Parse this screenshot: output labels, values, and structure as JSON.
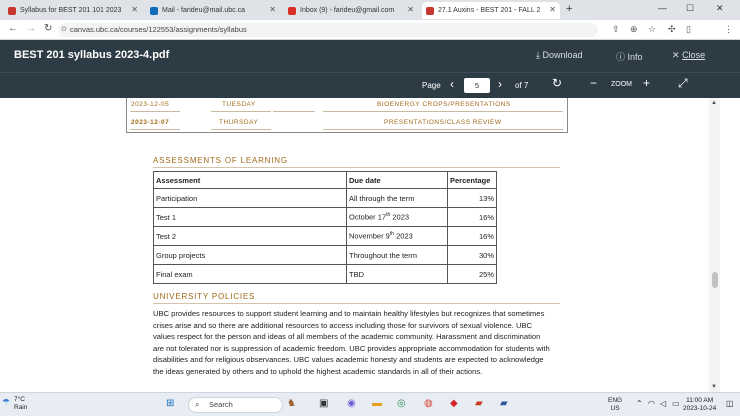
{
  "browser": {
    "tabs": [
      {
        "label": "Syllabus for BEST 201 101 2023",
        "color": "#c7372f",
        "active": false
      },
      {
        "label": "Mail - farideu@mail.ubc.ca",
        "color": "#0f6cbd",
        "active": false
      },
      {
        "label": "Inbox (9) - farideu@gmail.com",
        "color": "#d93025",
        "active": false
      },
      {
        "label": "27.1 Auxins - BEST 201 - FALL 2",
        "color": "#c7372f",
        "active": true
      }
    ],
    "new_tab": "+",
    "url": "canvas.ubc.ca/courses/122553/assignments/syllabus"
  },
  "viewer": {
    "title": "BEST 201 syllabus 2023-4.pdf",
    "download": "Download",
    "info": "Info",
    "close": "Close",
    "page_label": "Page",
    "page_value": "5",
    "page_total": "of 7",
    "zoom_label": "ZOOM"
  },
  "schedule": [
    {
      "date": "2023-12-05",
      "day": "TUESDAY",
      "topic": "BIOENERGY CROPS/PRESENTATIONS"
    },
    {
      "date": "2023-12-07",
      "day": "THURSDAY",
      "topic": "PRESENTATIONS/CLASS REVIEW"
    }
  ],
  "assessments": {
    "heading": "ASSESSMENTS OF LEARNING",
    "columns": [
      "Assessment",
      "Due date",
      "Percentage"
    ],
    "rows": [
      {
        "name": "Participation",
        "due": "All through the term",
        "pct": "13%"
      },
      {
        "name": "Test 1",
        "due_pre": "October 17",
        "due_sup": "th",
        "due_post": " 2023",
        "pct": "16%"
      },
      {
        "name": "Test 2",
        "due_pre": "November 9",
        "due_sup": "th",
        "due_post": " 2023",
        "pct": "16%"
      },
      {
        "name": "Group projects",
        "due": "Throughout the term",
        "pct": "30%"
      },
      {
        "name": "Final exam",
        "due": "TBD",
        "pct": "25%"
      }
    ]
  },
  "policies": {
    "heading": "UNIVERSITY POLICIES",
    "body": "UBC provides resources to support student learning and to maintain healthy lifestyles but recognizes that sometimes crises arise and so there are additional resources to access including those for survivors of sexual violence. UBC values respect for the person and ideas of all members of the academic community. Harassment and discrimination are not tolerated nor is suppression of academic freedom. UBC provides appropriate accommodation for students with disabilities and for religious observances. UBC values academic honesty and students are expected to acknowledge the ideas generated by others and to uphold the highest academic standards in all of their actions."
  },
  "taskbar": {
    "weather_temp": "7°C",
    "weather_desc": "Rain",
    "search_placeholder": "Search",
    "lang1": "ENG",
    "lang2": "US",
    "time": "11:00 AM",
    "date": "2023-10-24"
  }
}
